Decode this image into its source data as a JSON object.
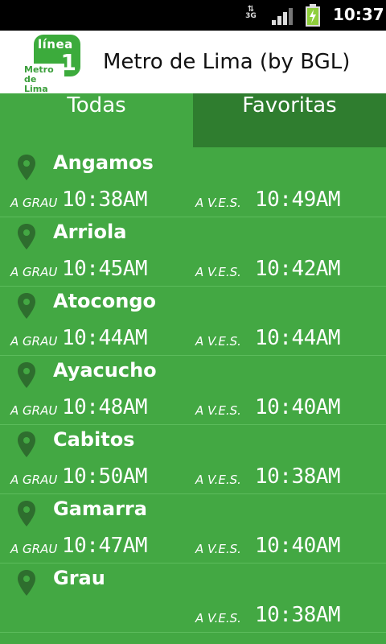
{
  "status_bar": {
    "network": "3G",
    "time": "10:37",
    "icons": [
      "data-arrows-icon",
      "signal-bars-icon",
      "battery-charging-icon"
    ]
  },
  "header": {
    "logo_line": "línea",
    "logo_number": "1",
    "logo_caption_1": "Metro",
    "logo_caption_2": "de Lima",
    "title": "Metro de Lima (by BGL)"
  },
  "tabs": [
    {
      "label": "Todas"
    },
    {
      "label": "Favoritas"
    }
  ],
  "stations": [
    {
      "name": "Angamos",
      "dir_grau": "A GRAU",
      "time_grau": "10:38AM",
      "dir_ves": "A V.E.S.",
      "time_ves": "10:49AM"
    },
    {
      "name": "Arriola",
      "dir_grau": "A GRAU",
      "time_grau": "10:45AM",
      "dir_ves": "A V.E.S.",
      "time_ves": "10:42AM"
    },
    {
      "name": "Atocongo",
      "dir_grau": "A GRAU",
      "time_grau": "10:44AM",
      "dir_ves": "A V.E.S.",
      "time_ves": "10:44AM"
    },
    {
      "name": "Ayacucho",
      "dir_grau": "A GRAU",
      "time_grau": "10:48AM",
      "dir_ves": "A V.E.S.",
      "time_ves": "10:40AM"
    },
    {
      "name": "Cabitos",
      "dir_grau": "A GRAU",
      "time_grau": "10:50AM",
      "dir_ves": "A V.E.S.",
      "time_ves": "10:38AM"
    },
    {
      "name": "Gamarra",
      "dir_grau": "A GRAU",
      "time_grau": "10:47AM",
      "dir_ves": "A V.E.S.",
      "time_ves": "10:40AM"
    },
    {
      "name": "Grau",
      "dir_grau": "",
      "time_grau": "",
      "dir_ves": "A V.E.S.",
      "time_ves": "10:38AM"
    }
  ],
  "colors": {
    "primary_green": "#43a843",
    "selected_tab": "#2f7d2f",
    "pin_color": "#2e6e2e"
  }
}
